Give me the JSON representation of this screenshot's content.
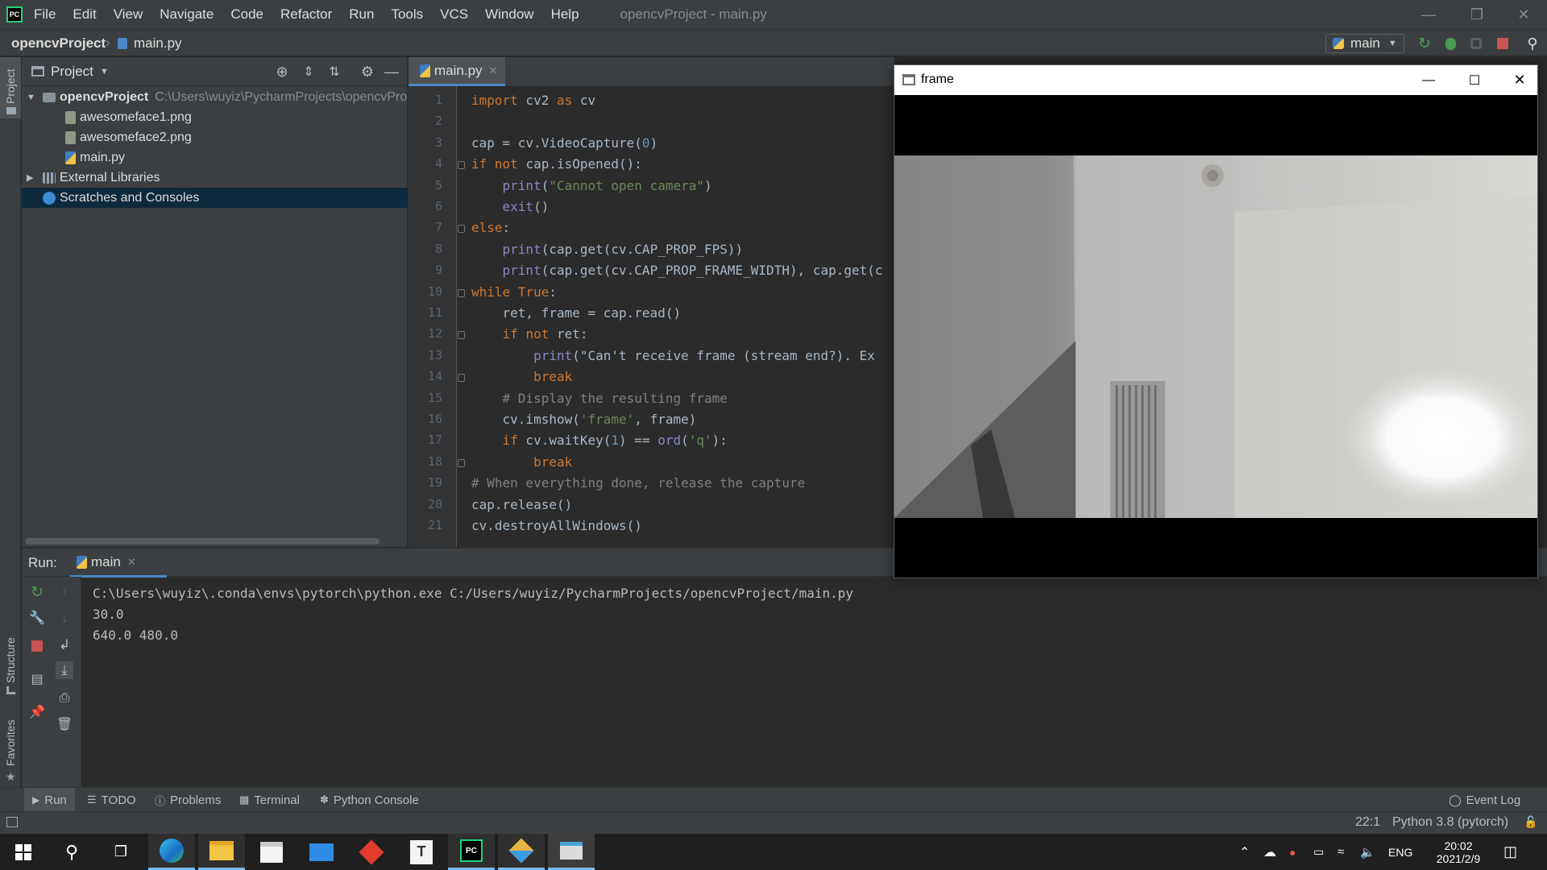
{
  "menubar": {
    "items": [
      "File",
      "Edit",
      "View",
      "Navigate",
      "Code",
      "Refactor",
      "Run",
      "Tools",
      "VCS",
      "Window",
      "Help"
    ],
    "window_title": "opencvProject - main.py",
    "logo": "PC"
  },
  "navbar": {
    "breadcrumb": [
      "opencvProject",
      "main.py"
    ],
    "run_config": "main"
  },
  "side_labels": {
    "project": "Project",
    "structure": "Structure",
    "favorites": "Favorites"
  },
  "project_panel": {
    "title": "Project",
    "tree": [
      {
        "label": "opencvProject",
        "path": "C:\\Users\\wuyiz\\PycharmProjects\\opencvPro",
        "icon": "folder-icon"
      },
      {
        "label": "awesomeface1.png",
        "icon": "image-file-icon"
      },
      {
        "label": "awesomeface2.png",
        "icon": "image-file-icon"
      },
      {
        "label": "main.py",
        "icon": "python-file-icon"
      },
      {
        "label": "External Libraries",
        "icon": "library-icon"
      },
      {
        "label": "Scratches and Consoles",
        "icon": "scratches-icon",
        "selected": true
      }
    ]
  },
  "editor": {
    "tab": "main.py",
    "line_numbers": [
      "1",
      "2",
      "3",
      "4",
      "5",
      "6",
      "7",
      "8",
      "9",
      "10",
      "11",
      "12",
      "13",
      "14",
      "15",
      "16",
      "17",
      "18",
      "19",
      "20",
      "21"
    ],
    "code_lines": [
      "import cv2 as cv",
      "",
      "cap = cv.VideoCapture(0)",
      "if not cap.isOpened():",
      "    print(\"Cannot open camera\")",
      "    exit()",
      "else:",
      "    print(cap.get(cv.CAP_PROP_FPS))",
      "    print(cap.get(cv.CAP_PROP_FRAME_WIDTH), cap.get(c",
      "while True:",
      "    ret, frame = cap.read()",
      "    if not ret:",
      "        print(\"Can't receive frame (stream end?). Ex",
      "        break",
      "    # Display the resulting frame",
      "    cv.imshow('frame', frame)",
      "    if cv.waitKey(1) == ord('q'):",
      "        break",
      "# When everything done, release the capture",
      "cap.release()",
      "cv.destroyAllWindows()"
    ]
  },
  "run_panel": {
    "label": "Run:",
    "tab": "main",
    "output": [
      "C:\\Users\\wuyiz\\.conda\\envs\\pytorch\\python.exe C:/Users/wuyiz/PycharmProjects/opencvProject/main.py",
      "30.0",
      "640.0 480.0"
    ]
  },
  "tool_tabs": [
    "Run",
    "TODO",
    "Problems",
    "Terminal",
    "Python Console"
  ],
  "event_log": "Event Log",
  "status": {
    "position": "22:1",
    "interpreter": "Python 3.8 (pytorch)"
  },
  "frame_window": {
    "title": "frame"
  },
  "taskbar": {
    "time": "20:02",
    "date": "2021/2/9",
    "lang": "ENG",
    "apps": [
      "start-icon",
      "search-icon",
      "task-view-icon",
      "edge-icon",
      "file-explorer-icon",
      "store-icon",
      "mail-icon",
      "app-red-icon",
      "typora-icon",
      "pycharm-icon",
      "git-icon",
      "frame-window-icon"
    ]
  },
  "colors": {
    "ide_background": "#2b2b2b",
    "panel": "#3c3f41",
    "keyword": "#cc7832",
    "string": "#6a8759",
    "number": "#6897bb",
    "comment": "#808080",
    "selection": "#0d293e",
    "run_green": "#499c54",
    "stop_red": "#c75450"
  }
}
